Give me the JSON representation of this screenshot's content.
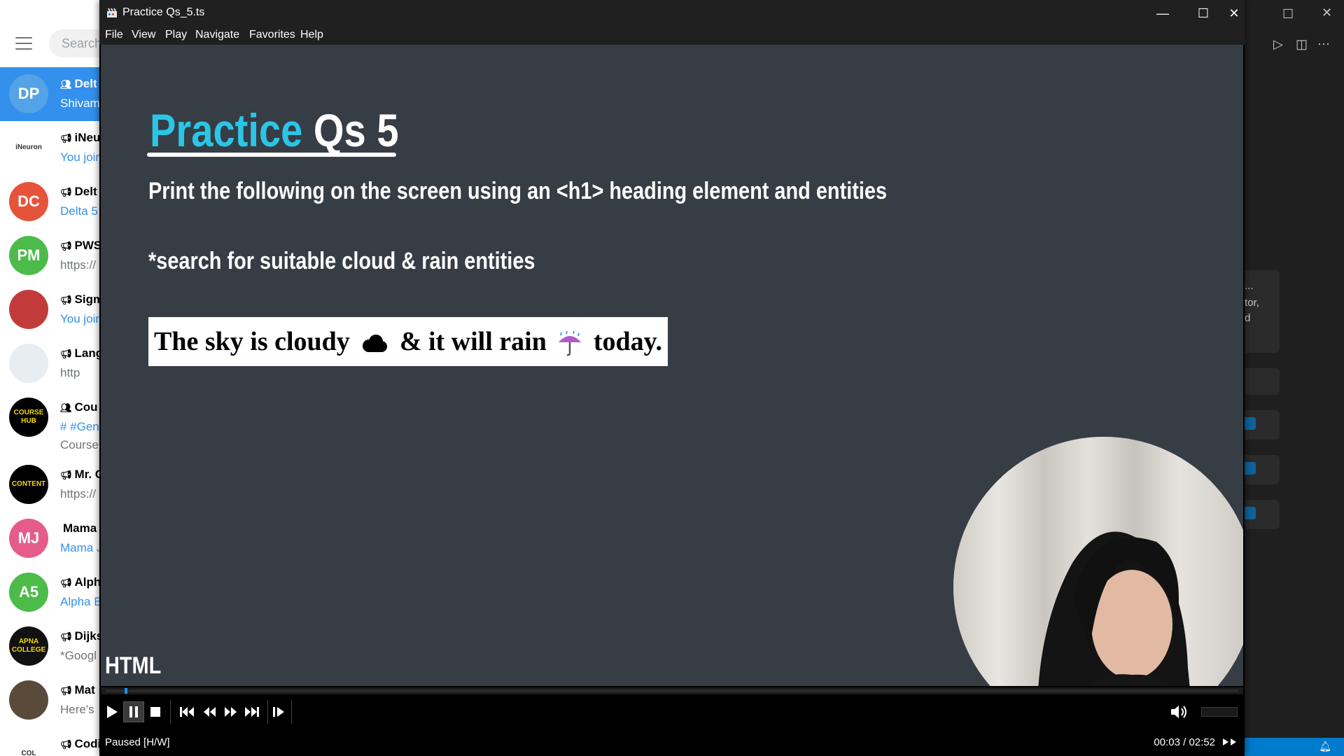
{
  "chat_app": {
    "search_placeholder": "Search",
    "chats": [
      {
        "avatar": "DP",
        "color": "#54a3e6",
        "name": "Delt",
        "snippet": "Shivam",
        "type": "group",
        "active": true
      },
      {
        "avatar": "",
        "color": "#ffffff",
        "name": "iNeu",
        "snippet": "You join",
        "type": "channel",
        "logo": "iNeuron"
      },
      {
        "avatar": "DC",
        "color": "#e5533a",
        "name": "Delt",
        "snippet": "Delta 5",
        "type": "channel"
      },
      {
        "avatar": "PM",
        "color": "#4cbb4a",
        "name": "PWS",
        "snippet": "https://",
        "type": "channel",
        "grey": true
      },
      {
        "avatar": "",
        "color": "#c23b3b",
        "name": "Sigm",
        "snippet": "You join",
        "type": "channel"
      },
      {
        "avatar": "",
        "color": "#e8edf2",
        "name": "Lang",
        "snippet": "http",
        "type": "channel",
        "grey": true
      },
      {
        "avatar": "",
        "color": "#000000",
        "name": "Cou",
        "snippet": "# #Gen",
        "snippet2": "Course",
        "type": "group",
        "logo": "COURSE HUB"
      },
      {
        "avatar": "",
        "color": "#000000",
        "name": "Mr. C",
        "snippet": "https://",
        "type": "channel",
        "logo": "CONTENT",
        "grey": true
      },
      {
        "avatar": "MJ",
        "color": "#e55c8a",
        "name": "Mama J",
        "snippet": "Mama J",
        "type": "plain"
      },
      {
        "avatar": "A5",
        "color": "#4cbb4a",
        "name": "Alph",
        "snippet": "Alpha B",
        "type": "channel"
      },
      {
        "avatar": "",
        "color": "#111111",
        "name": "Dijks",
        "snippet": "*Googl",
        "type": "channel",
        "logo": "APNA COLLEGE",
        "grey": true
      },
      {
        "avatar": "",
        "color": "#5a4a3a",
        "name": "Mat",
        "snippet": "Here's",
        "type": "channel",
        "grey": true
      },
      {
        "avatar": "",
        "color": "#ffffff",
        "name": "Codi",
        "snippet": "",
        "type": "channel",
        "logo": "COL"
      }
    ]
  },
  "editor": {
    "card_text_1": "...",
    "card_text_2": "tor,",
    "card_text_3": "d"
  },
  "player": {
    "window_title": "Practice Qs_5.ts",
    "menu": [
      "File",
      "View",
      "Play",
      "Navigate",
      "Favorites",
      "Help"
    ],
    "video": {
      "title_word1": "Practice",
      "title_word2": "Qs 5",
      "instruction": "Print the following on the screen using an <h1> heading element and entities",
      "hint": "*search for suitable cloud & rain entities",
      "example_part1": "The sky is cloudy",
      "example_part2": "& it will rain",
      "example_part3": "today.",
      "corner_label": "HTML"
    },
    "seek_progress": 0.0174,
    "volume_level": 0.0,
    "status": "Paused [H/W]",
    "time_display": "00:03 / 02:52"
  }
}
